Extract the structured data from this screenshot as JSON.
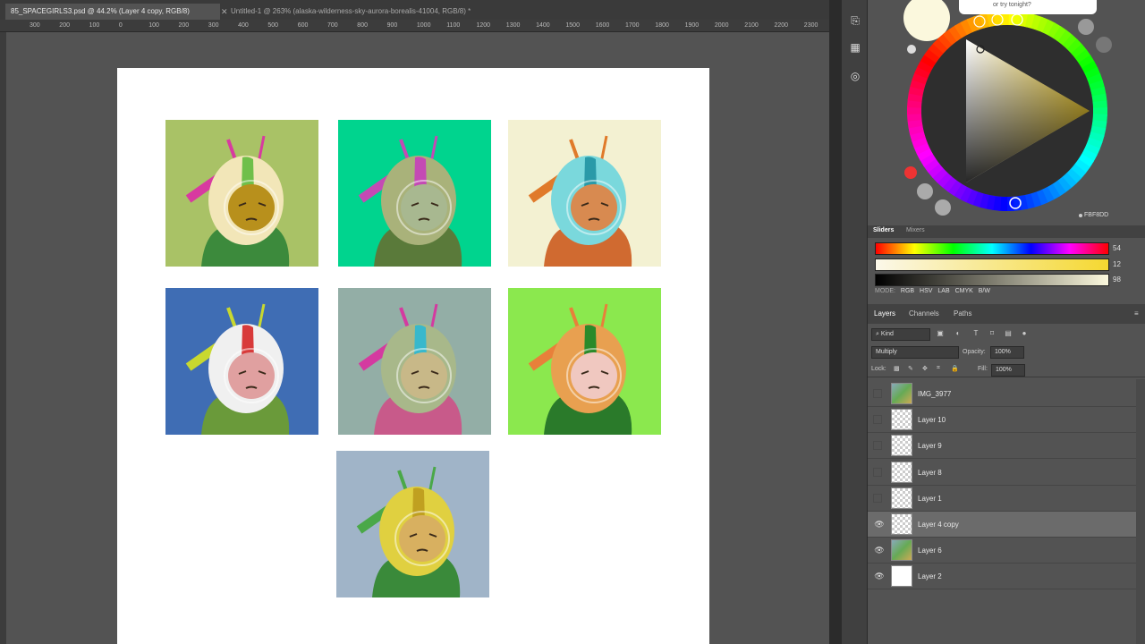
{
  "tabs": [
    {
      "label": "85_SPACEGIRLS3.psd @ 44.2% (Layer 4 copy, RGB/8)",
      "active": true
    },
    {
      "label": "Untitled-1 @ 263% (alaska-wilderness-sky-aurora-borealis-41004, RGB/8) *",
      "active": false
    }
  ],
  "ruler": [
    "300",
    "200",
    "100",
    "0",
    "100",
    "200",
    "300",
    "400",
    "500",
    "600",
    "700",
    "800",
    "900",
    "1000",
    "1100",
    "1200",
    "1300",
    "1400",
    "1500",
    "1600",
    "1700",
    "1800",
    "1900",
    "2000",
    "2100",
    "2200",
    "2300"
  ],
  "tooltip": "or try tonight?",
  "color": {
    "hex": "FBF8DD",
    "tabs": {
      "sliders": "Sliders",
      "mixers": "Mixers"
    },
    "h": "54",
    "s": "12",
    "b": "98",
    "mode_label": "MODE:",
    "modes": [
      "RGB",
      "HSV",
      "LAB",
      "CMYK",
      "B/W"
    ]
  },
  "layers_panel": {
    "tabs": [
      "Layers",
      "Channels",
      "Paths"
    ],
    "filter": "Kind",
    "blend": "Multiply",
    "opacity_label": "Opacity:",
    "opacity": "100%",
    "lock_label": "Lock:",
    "fill_label": "Fill:",
    "fill": "100%",
    "layers": [
      {
        "name": "IMG_3977",
        "visible": false,
        "thumb": "img",
        "selected": false
      },
      {
        "name": "Layer 10",
        "visible": false,
        "thumb": "trans",
        "selected": false
      },
      {
        "name": "Layer 9",
        "visible": false,
        "thumb": "trans",
        "selected": false
      },
      {
        "name": "Layer 8",
        "visible": false,
        "thumb": "trans",
        "selected": false
      },
      {
        "name": "Layer 1",
        "visible": false,
        "thumb": "trans",
        "selected": false
      },
      {
        "name": "Layer 4 copy",
        "visible": true,
        "thumb": "trans",
        "selected": true
      },
      {
        "name": "Layer 6",
        "visible": true,
        "thumb": "img",
        "selected": false
      },
      {
        "name": "Layer 2",
        "visible": true,
        "thumb": "white",
        "selected": false
      }
    ]
  },
  "thumbs": [
    {
      "bg": "#a9c266",
      "helmet": "#f2e6b8",
      "stripe": "#6fbf4a",
      "face": "#b8901c",
      "accent": "#d83aa0",
      "body": "#3c8a3c"
    },
    {
      "bg": "#00d48e",
      "helmet": "#a9b27a",
      "stripe": "#c44ab4",
      "face": "#a8b890",
      "accent": "#c44ab4",
      "body": "#5a7a3a"
    },
    {
      "bg": "#f3f1d2",
      "helmet": "#7ad8dc",
      "stripe": "#2a9aa8",
      "face": "#d88a50",
      "accent": "#e07a2a",
      "body": "#d06a30"
    },
    {
      "bg": "#3f6db4",
      "helmet": "#f0f0f0",
      "stripe": "#d83a3a",
      "face": "#e0a0a0",
      "accent": "#c8d830",
      "body": "#6a9a3a"
    },
    {
      "bg": "#93aea6",
      "helmet": "#a8b88a",
      "stripe": "#38b8cc",
      "face": "#c8b888",
      "accent": "#d43aa0",
      "body": "#c85a8a"
    },
    {
      "bg": "#8be84e",
      "helmet": "#e8a050",
      "stripe": "#2a8a2a",
      "face": "#f0c8c0",
      "accent": "#e8803a",
      "body": "#2a7a2a"
    },
    {
      "bg": "#a0b4c8",
      "helmet": "#e0d040",
      "stripe": "#c0a020",
      "face": "#d8b060",
      "accent": "#4aa848",
      "body": "#3a8a3a"
    }
  ]
}
